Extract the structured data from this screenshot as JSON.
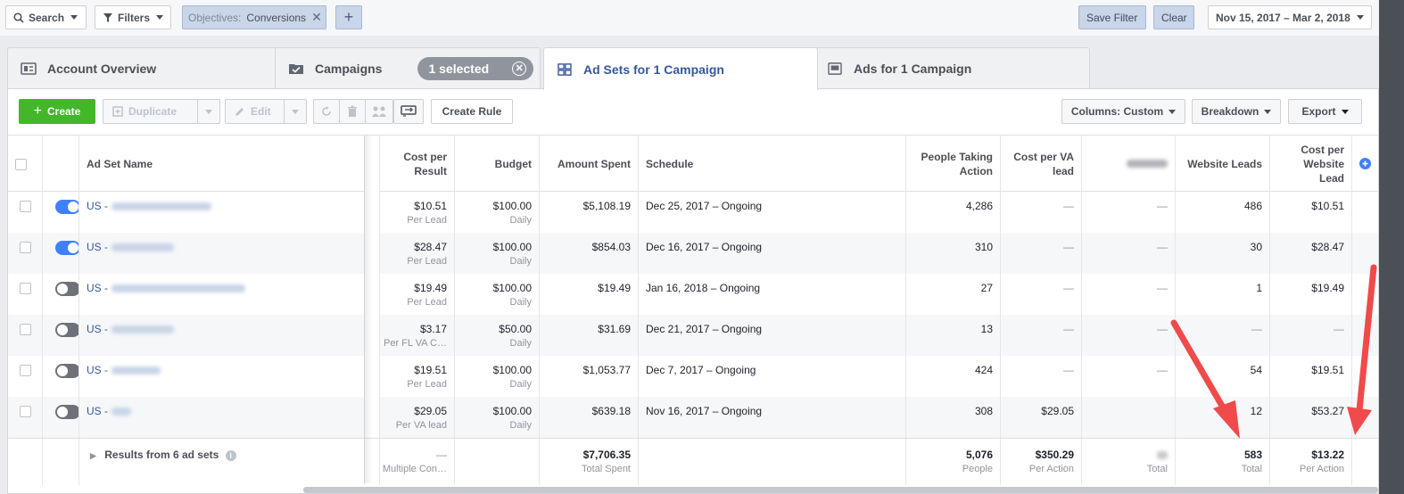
{
  "topbar": {
    "search_label": "Search",
    "filters_label": "Filters",
    "objective_label": "Objectives:",
    "objective_value": "Conversions",
    "add_label": "+",
    "save_filter": "Save Filter",
    "clear": "Clear",
    "date_range": "Nov 15, 2017 – Mar 2, 2018"
  },
  "tabs": {
    "account_overview": "Account Overview",
    "campaigns": "Campaigns",
    "selected": "1 selected",
    "ad_sets": "Ad Sets for 1 Campaign",
    "ads": "Ads for 1 Campaign"
  },
  "toolbar": {
    "create": "Create",
    "duplicate": "Duplicate",
    "edit": "Edit",
    "create_rule": "Create Rule",
    "columns": "Columns: Custom",
    "breakdown": "Breakdown",
    "export": "Export"
  },
  "columns": {
    "name": "Ad Set Name",
    "cost_per_result": "Cost per Result",
    "budget": "Budget",
    "amount_spent": "Amount Spent",
    "schedule": "Schedule",
    "people_taking_action": "People Taking Action",
    "cost_per_va_lead": "Cost per VA lead",
    "website_leads": "Website Leads",
    "cost_per_website_lead": "Cost per Website Lead"
  },
  "rows": [
    {
      "name": "US -",
      "on": true,
      "cpr": "$10.51",
      "cpr_sub": "Per Lead",
      "budget": "$100.00",
      "budget_sub": "Daily",
      "spent": "$5,108.19",
      "schedule": "Dec 25, 2017 – Ongoing",
      "people": "4,286",
      "cpva": "—",
      "hidden": "—",
      "leads": "486",
      "cpwl": "$10.51"
    },
    {
      "name": "US -",
      "on": true,
      "cpr": "$28.47",
      "cpr_sub": "Per Lead",
      "budget": "$100.00",
      "budget_sub": "Daily",
      "spent": "$854.03",
      "schedule": "Dec 16, 2017 – Ongoing",
      "people": "310",
      "cpva": "—",
      "hidden": "—",
      "leads": "30",
      "cpwl": "$28.47"
    },
    {
      "name": "US -",
      "on": false,
      "cpr": "$19.49",
      "cpr_sub": "Per Lead",
      "budget": "$100.00",
      "budget_sub": "Daily",
      "spent": "$19.49",
      "schedule": "Jan 16, 2018 – Ongoing",
      "people": "27",
      "cpva": "—",
      "hidden": "—",
      "leads": "1",
      "cpwl": "$19.49"
    },
    {
      "name": "US -",
      "on": false,
      "cpr": "$3.17",
      "cpr_sub": "Per FL VA C…",
      "budget": "$50.00",
      "budget_sub": "Daily",
      "spent": "$31.69",
      "schedule": "Dec 21, 2017 – Ongoing",
      "people": "13",
      "cpva": "—",
      "hidden": "—",
      "leads": "—",
      "cpwl": "—"
    },
    {
      "name": "US -",
      "on": false,
      "cpr": "$19.51",
      "cpr_sub": "Per Lead",
      "budget": "$100.00",
      "budget_sub": "Daily",
      "spent": "$1,053.77",
      "schedule": "Dec 7, 2017 – Ongoing",
      "people": "424",
      "cpva": "—",
      "hidden": "—",
      "leads": "54",
      "cpwl": "$19.51"
    },
    {
      "name": "US -",
      "on": false,
      "cpr": "$29.05",
      "cpr_sub": "Per VA lead",
      "budget": "$100.00",
      "budget_sub": "Daily",
      "spent": "$639.18",
      "schedule": "Nov 16, 2017 – Ongoing",
      "people": "308",
      "cpva": "$29.05",
      "hidden": "",
      "leads": "12",
      "cpwl": "$53.27"
    }
  ],
  "totals": {
    "label": "Results from 6 ad sets",
    "cpr": "—",
    "cpr_sub": "Multiple Con…",
    "spent": "$7,706.35",
    "spent_sub": "Total Spent",
    "people": "5,076",
    "people_sub": "People",
    "cpva": "$350.29",
    "cpva_sub": "Per Action",
    "hidden_sub": "Total",
    "leads": "583",
    "leads_sub": "Total",
    "cpwl": "$13.22",
    "cpwl_sub": "Per Action"
  },
  "colors": {
    "accent": "#365899",
    "create_green": "#42b72a",
    "toggle_on": "#4080ff",
    "annotation_arrow": "#f04a4a"
  }
}
